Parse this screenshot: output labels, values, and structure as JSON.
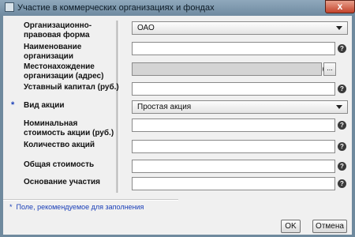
{
  "window": {
    "title": "Участие в коммерческих организациях и фондах",
    "close_glyph": "x"
  },
  "form": {
    "org_form": {
      "label": "Организационно-правовая форма",
      "value": "ОАО"
    },
    "name": {
      "label": "Наименование организации",
      "value": ""
    },
    "address": {
      "label": "Местонахождение организации (адрес)",
      "value": "",
      "browse_label": "..."
    },
    "charter_capital": {
      "label": "Уставный капитал (руб.)",
      "value": ""
    },
    "share_type": {
      "label": "Вид акции",
      "value": "Простая акция",
      "required_mark": "*"
    },
    "nominal_value": {
      "label": "Номинальная стоимость акции (руб.)",
      "value": ""
    },
    "share_count": {
      "label": "Количество акций",
      "value": ""
    },
    "total_value": {
      "label": "Общая стоимость",
      "value": ""
    },
    "basis": {
      "label": "Основание участия",
      "value": ""
    },
    "help_glyph": "?"
  },
  "footnote": {
    "mark": "*",
    "text": "Поле, рекомендуемое для заполнения"
  },
  "buttons": {
    "ok": "OK",
    "cancel": "Отмена"
  }
}
